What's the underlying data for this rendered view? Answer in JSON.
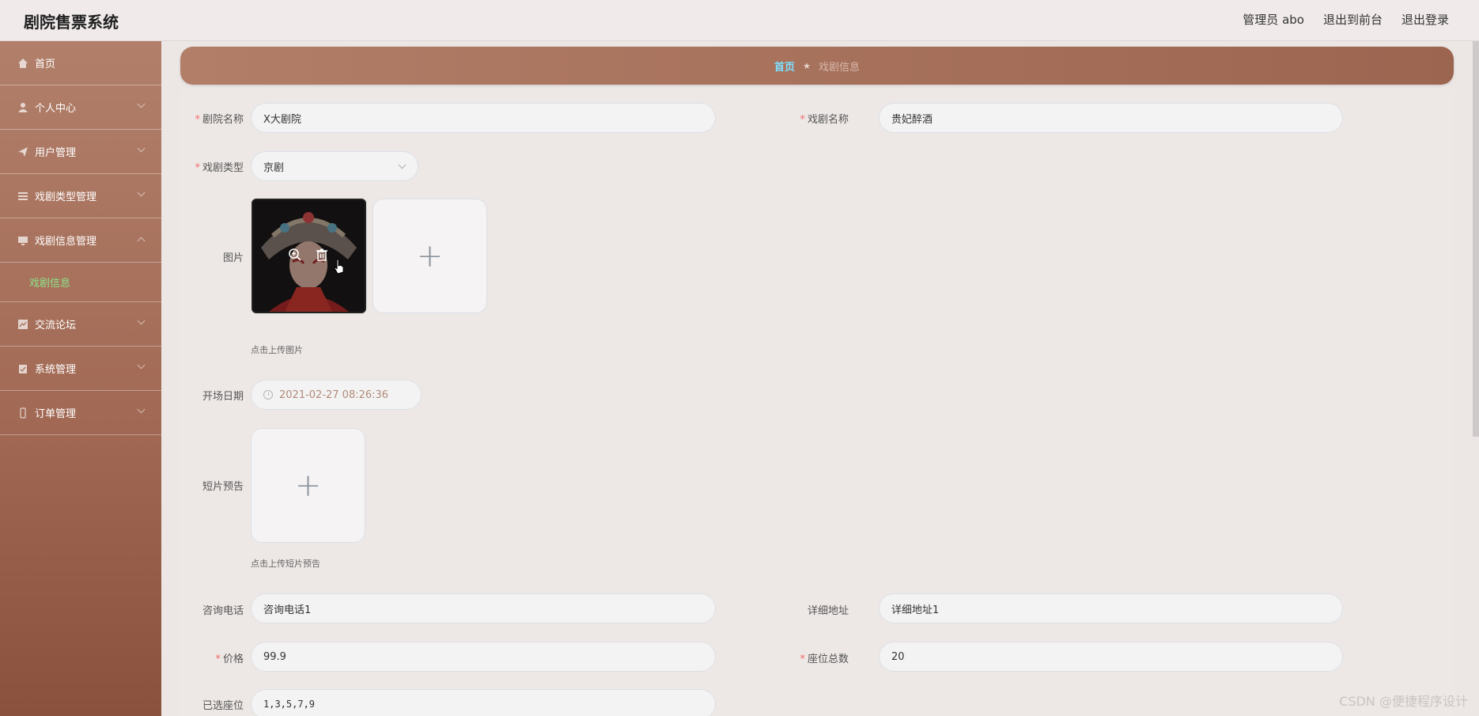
{
  "header": {
    "app_title": "剧院售票系统",
    "admin_label": "管理员 abo",
    "to_frontend": "退出到前台",
    "logout": "退出登录"
  },
  "sidebar": {
    "items": [
      {
        "label": "首页",
        "icon": "home-icon"
      },
      {
        "label": "个人中心",
        "icon": "user-icon"
      },
      {
        "label": "用户管理",
        "icon": "send-icon"
      },
      {
        "label": "戏剧类型管理",
        "icon": "menu-icon"
      },
      {
        "label": "戏剧信息管理",
        "icon": "monitor-icon"
      },
      {
        "label": "交流论坛",
        "icon": "chart-icon"
      },
      {
        "label": "系统管理",
        "icon": "clipboard-icon"
      },
      {
        "label": "订单管理",
        "icon": "mobile-icon"
      }
    ],
    "active_sub": "戏剧信息"
  },
  "breadcrumb": {
    "home": "首页",
    "current": "戏剧信息"
  },
  "form": {
    "theater_name_label": "剧院名称",
    "theater_name_value": "X大剧院",
    "drama_name_label": "戏剧名称",
    "drama_name_value": "贵妃醉酒",
    "drama_type_label": "戏剧类型",
    "drama_type_value": "京剧",
    "image_label": "图片",
    "image_hint": "点击上传图片",
    "date_label": "开场日期",
    "date_value": "2021-02-27 08:26:36",
    "video_label": "短片预告",
    "video_hint": "点击上传短片预告",
    "phone_label": "咨询电话",
    "phone_value": "咨询电话1",
    "address_label": "详细地址",
    "address_value": "详细地址1",
    "price_label": "价格",
    "price_value": "99.9",
    "seats_label": "座位总数",
    "seats_value": "20",
    "selected_seats_label": "已选座位",
    "selected_seats_value": "1,3,5,7,9"
  },
  "watermark": "CSDN @便捷程序设计"
}
